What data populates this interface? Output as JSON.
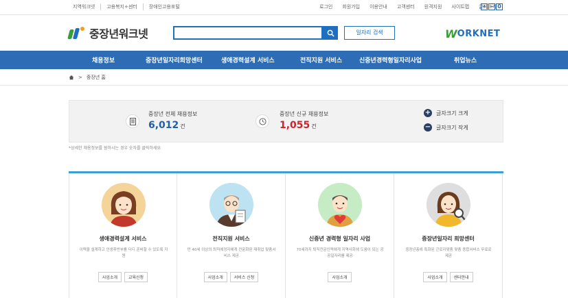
{
  "topbar": {
    "left_links": [
      "지역워크넷",
      "고용복지+센터",
      "장애인고용포털"
    ],
    "right_links": [
      "로그인",
      "회원가입",
      "이용안내",
      "고객센터",
      "원격지원",
      "사이트맵",
      "글자크기"
    ],
    "font_controls": [
      "+",
      "−",
      "0"
    ]
  },
  "header": {
    "logo_text": "중장년워크넷",
    "search_placeholder": "",
    "detail_search_label": "일자리 검색",
    "worknet_w": "W",
    "worknet_rest": "ORKNET"
  },
  "nav": {
    "items": [
      "채용정보",
      "중장년일자리희망센터",
      "생애경력설계 서비스",
      "전직지원 서비스",
      "신중년경력형일자리사업",
      "취업뉴스"
    ]
  },
  "breadcrumb": {
    "home_icon": "home-icon",
    "separator": ">",
    "current": "중장년 홈"
  },
  "stats": {
    "total": {
      "label": "중장년 전체 채용정보",
      "value": "6,012",
      "unit": "건",
      "color": "#1f5fa8"
    },
    "new": {
      "label": "중장년 신규 채용정보",
      "value": "1,055",
      "unit": "건",
      "color": "#d0202a"
    },
    "font_bigger": "글자크기 크게",
    "font_smaller": "글자크기 작게"
  },
  "note": "*상세한 채용정보를 원하시는 경우 숫자를 클릭하세요",
  "cards": [
    {
      "title": "생애경력설계 서비스",
      "desc": "이력을 설계하고 인생후반부를 더디 준비할 수 있도록 지원",
      "buttons": [
        "사업소개",
        "교육신청"
      ]
    },
    {
      "title": "전직지원 서비스",
      "desc": "만 40세 이상의 퇴직예정자에게 전문화된 재취업 맞춤서비스 제공",
      "buttons": [
        "사업소개",
        "서비스 신청"
      ]
    },
    {
      "title": "신중년 경력형 일자리 사업",
      "desc": "70세까지 퇴직전문인력에게 지역사회에 도움이 되는 공공일자리를 제공",
      "buttons": [
        "사업소개"
      ]
    },
    {
      "title": "중장년일자리 희망센터",
      "desc": "중장년층에 특화된 근로자맞춤 맞춤 종합서비스 무료로 제공",
      "buttons": [
        "사업소개",
        "센터안내"
      ]
    }
  ],
  "colors": {
    "nav_bg": "#2e6db4",
    "accent_blue": "#1f6fc0",
    "accent_green": "#3a9d3a",
    "card_top_border": "#3b9fd6"
  }
}
